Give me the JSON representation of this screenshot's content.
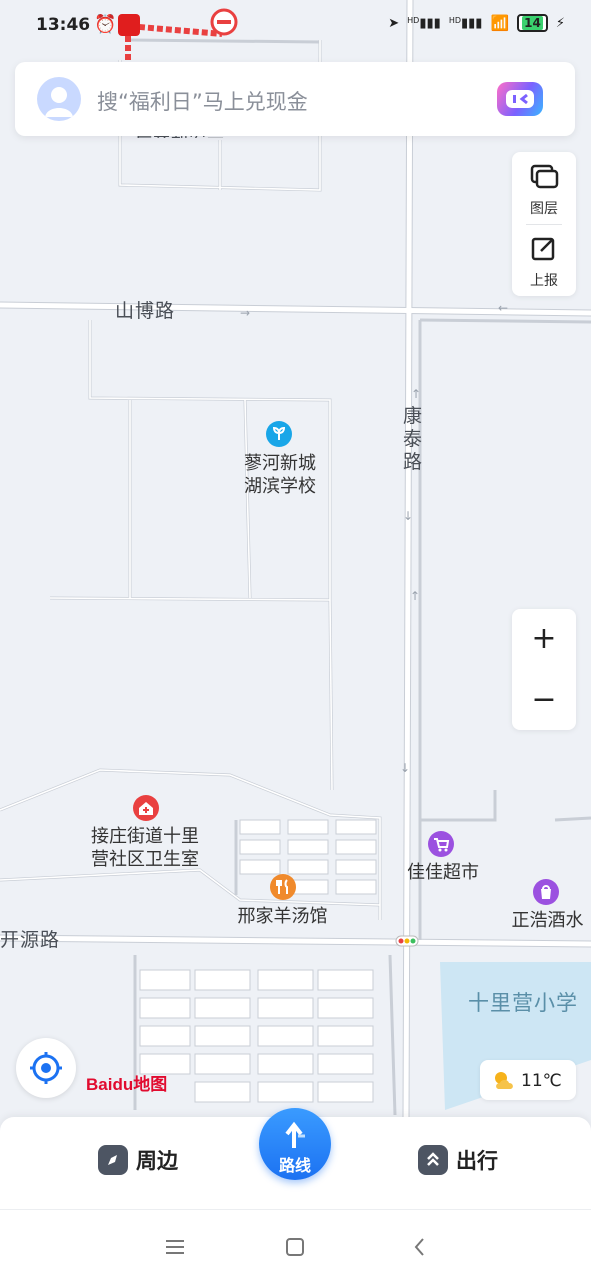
{
  "status_bar": {
    "time": "13:46",
    "network_1": "HD",
    "network_2": "HD",
    "battery": "14"
  },
  "search": {
    "placeholder": "搜“福利日”马上兑现金"
  },
  "side_panel": {
    "layers_label": "图层",
    "report_label": "上报"
  },
  "zoom": {
    "in_label": "+",
    "out_label": "−"
  },
  "map": {
    "roads": {
      "shanbo": "山博路",
      "kaiyuan": "开源路",
      "kangtai": "康泰路"
    },
    "partial_label_top": "后案利安云",
    "pois": {
      "school": {
        "name_line1": "蓼河新城",
        "name_line2": "湖滨学校",
        "color": "#19a6e8"
      },
      "clinic": {
        "name_line1": "接庄街道十里",
        "name_line2": "营社区卫生室",
        "color": "#e94040"
      },
      "restaurant": {
        "name": "邢家羊汤馆",
        "color": "#f08a2c"
      },
      "supermarket": {
        "name": "佳佳超市",
        "color": "#9b51e0"
      },
      "liquor": {
        "name": "正浩酒水",
        "color": "#9b51e0"
      },
      "primary_school": {
        "name": "十里营小学"
      }
    }
  },
  "brand": {
    "logo_text": "Baidu地图"
  },
  "weather": {
    "temp": "11℃"
  },
  "bottom_bar": {
    "nearby": "周边",
    "route": "路线",
    "travel": "出行"
  },
  "colors": {
    "accent": "#1c72f2",
    "map_bg": "#eef1f6",
    "road": "#ffffff",
    "road_edge": "#c9ced6",
    "water": "#cde6f4"
  }
}
